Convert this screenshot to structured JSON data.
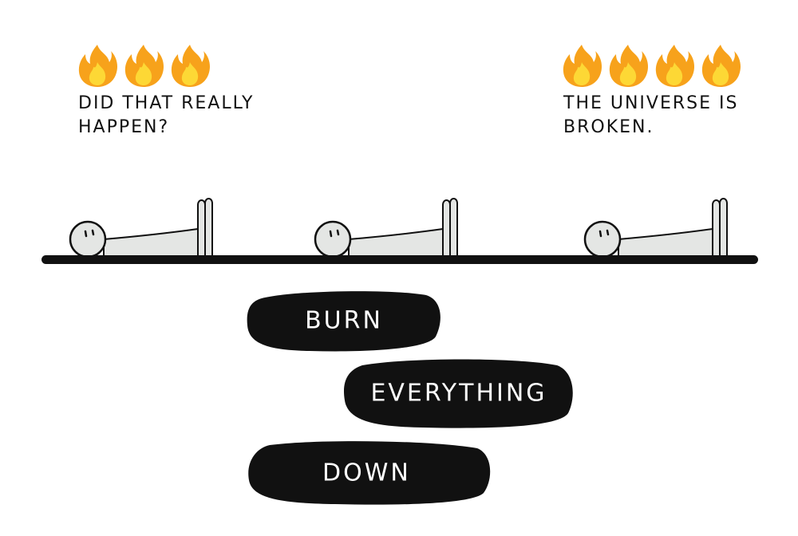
{
  "panels": [
    {
      "flame_icon": "fire-emoji",
      "flame_count": 3,
      "caption": "DID THAT REALLY\nHAPPEN?"
    },
    {
      "flame_icon": "fire-emoji",
      "flame_count": 4,
      "caption": "THE UNIVERSE IS\nBROKEN."
    }
  ],
  "figures": [
    "lying-stick-figure",
    "lying-stick-figure",
    "lying-stick-figure"
  ],
  "blobs": [
    "BURN",
    "EVERYTHING",
    "DOWN"
  ],
  "colors": {
    "ink": "#111111",
    "flame_outer": "#f7a21b",
    "flame_inner": "#fdd835",
    "figure_fill": "#e4e6e4"
  }
}
